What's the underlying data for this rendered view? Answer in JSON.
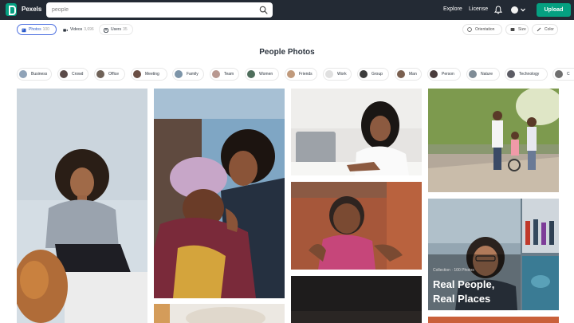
{
  "app": {
    "name": "Pexels"
  },
  "search": {
    "value": "people"
  },
  "nav": {
    "explore": "Explore",
    "license": "License",
    "upload": "Upload"
  },
  "tabs": [
    {
      "label": "Photos",
      "count": "100"
    },
    {
      "label": "Videos",
      "count": "3,696"
    },
    {
      "label": "Users",
      "count": "35"
    }
  ],
  "filters": {
    "orientation": "Orientation",
    "size": "Size",
    "color": "Color"
  },
  "page_title": "People Photos",
  "chips": [
    "Business",
    "Crowd",
    "Office",
    "Meeting",
    "Family",
    "Team",
    "Women",
    "Friends",
    "Work",
    "Group",
    "Man",
    "Person",
    "Nature",
    "Technology"
  ],
  "collection": {
    "subtitle": "Collection · 100 Photos",
    "title_line1": "Real People,",
    "title_line2": "Real Places"
  },
  "colors": {
    "brand": "#05a081",
    "topbar": "#232a34",
    "accent": "#4a6ee0"
  }
}
